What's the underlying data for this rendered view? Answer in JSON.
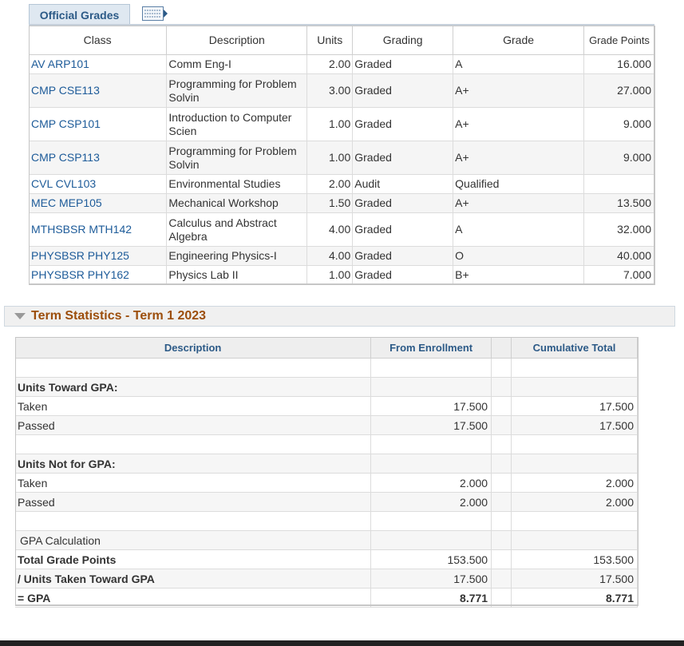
{
  "official_grades": {
    "tab_label": "Official Grades",
    "view_all_icon": "grid-view-icon",
    "headers": {
      "class": "Class",
      "description": "Description",
      "units": "Units",
      "grading": "Grading",
      "grade": "Grade",
      "grade_points": "Grade Points"
    },
    "rows": [
      {
        "class": "AV ARP101",
        "description": "Comm Eng-I",
        "units": "2.00",
        "grading": "Graded",
        "grade": "A",
        "grade_points": "16.000"
      },
      {
        "class": "CMP CSE113",
        "description": "Programming for Problem Solvin",
        "units": "3.00",
        "grading": "Graded",
        "grade": "A+",
        "grade_points": "27.000"
      },
      {
        "class": "CMP CSP101",
        "description": "Introduction to Computer Scien",
        "units": "1.00",
        "grading": "Graded",
        "grade": "A+",
        "grade_points": "9.000"
      },
      {
        "class": "CMP CSP113",
        "description": "Programming for Problem Solvin",
        "units": "1.00",
        "grading": "Graded",
        "grade": "A+",
        "grade_points": "9.000"
      },
      {
        "class": "CVL CVL103",
        "description": "Environmental Studies",
        "units": "2.00",
        "grading": "Audit",
        "grade": "Qualified",
        "grade_points": ""
      },
      {
        "class": "MEC MEP105",
        "description": "Mechanical Workshop",
        "units": "1.50",
        "grading": "Graded",
        "grade": "A+",
        "grade_points": "13.500"
      },
      {
        "class": "MTHSBSR MTH142",
        "description": "Calculus and Abstract Algebra",
        "units": "4.00",
        "grading": "Graded",
        "grade": "A",
        "grade_points": "32.000"
      },
      {
        "class": "PHYSBSR PHY125",
        "description": "Engineering Physics-I",
        "units": "4.00",
        "grading": "Graded",
        "grade": "O",
        "grade_points": "40.000"
      },
      {
        "class": "PHYSBSR PHY162",
        "description": "Physics Lab II",
        "units": "1.00",
        "grading": "Graded",
        "grade": "B+",
        "grade_points": "7.000"
      }
    ]
  },
  "term_statistics": {
    "title": "Term Statistics - Term 1 2023",
    "collapse_icon": "triangle-down-icon",
    "headers": {
      "description": "Description",
      "from_enrollment": "From Enrollment",
      "cumulative_total": "Cumulative Total"
    },
    "units_toward_gpa": {
      "heading": "Units Toward GPA:",
      "taken_label": "Taken",
      "taken_enrollment": "17.500",
      "taken_cumulative": "17.500",
      "passed_label": "Passed",
      "passed_enrollment": "17.500",
      "passed_cumulative": "17.500"
    },
    "units_not_for_gpa": {
      "heading": "Units Not for GPA:",
      "taken_label": "Taken",
      "taken_enrollment": "2.000",
      "taken_cumulative": "2.000",
      "passed_label": "Passed",
      "passed_enrollment": "2.000",
      "passed_cumulative": "2.000"
    },
    "gpa_calculation": {
      "heading": "GPA Calculation",
      "total_points_label": "Total Grade Points",
      "total_points_enrollment": "153.500",
      "total_points_cumulative": "153.500",
      "units_taken_label": "/ Units Taken Toward GPA",
      "units_taken_enrollment": "17.500",
      "units_taken_cumulative": "17.500",
      "gpa_label": "= GPA",
      "gpa_enrollment": "8.771",
      "gpa_cumulative": "8.771"
    }
  }
}
